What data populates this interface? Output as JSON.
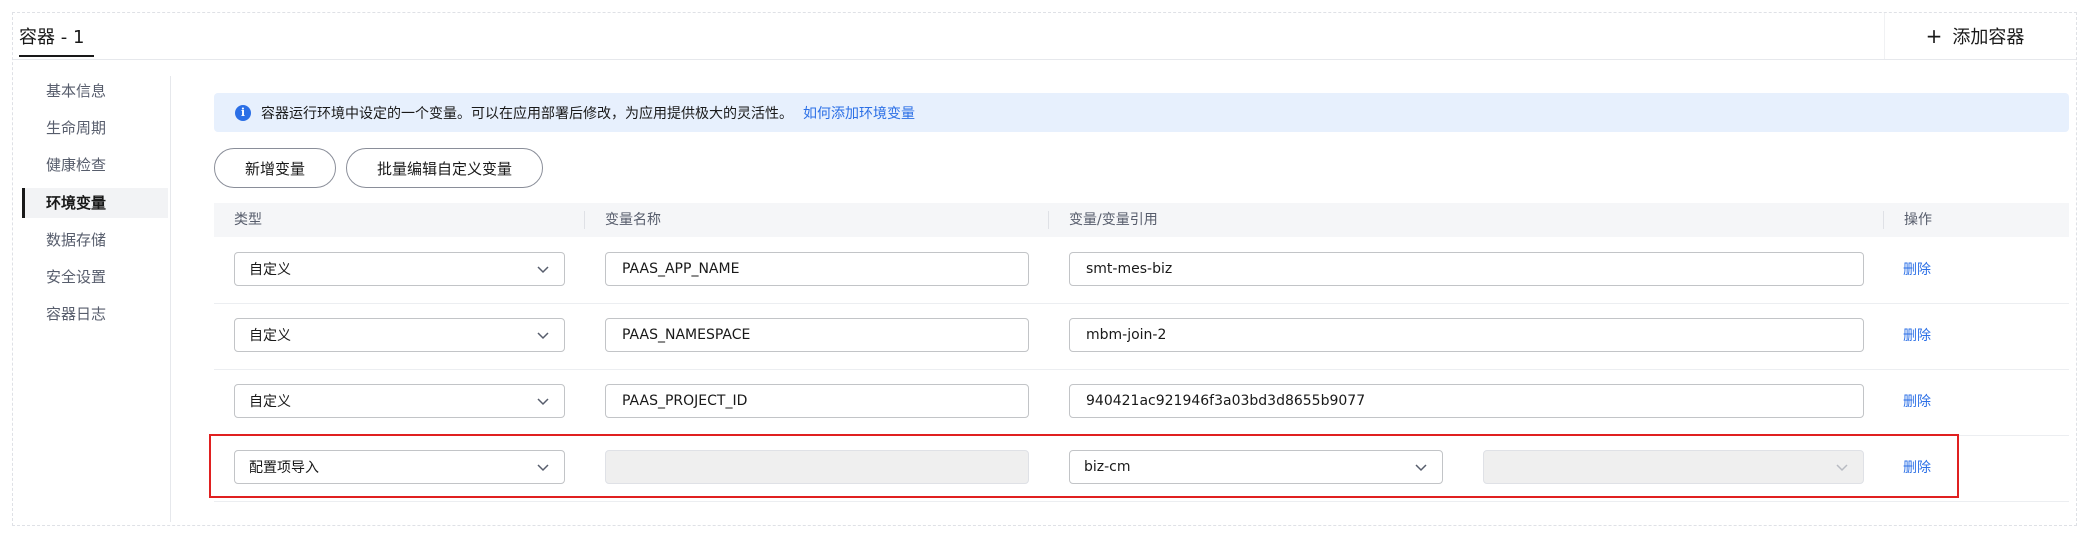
{
  "tabs": {
    "active_label": "容器 - 1"
  },
  "add_container": {
    "plus": "+",
    "label": "添加容器"
  },
  "sidebar": {
    "items": [
      {
        "label": "基本信息"
      },
      {
        "label": "生命周期"
      },
      {
        "label": "健康检查"
      },
      {
        "label": "环境变量",
        "active": true
      },
      {
        "label": "数据存储"
      },
      {
        "label": "安全设置"
      },
      {
        "label": "容器日志"
      }
    ]
  },
  "info": {
    "icon": "info-icon",
    "text": "容器运行环境中设定的一个变量。可以在应用部署后修改，为应用提供极大的灵活性。",
    "link": "如何添加环境变量"
  },
  "toolbar": {
    "add_label": "新增变量",
    "batch_label": "批量编辑自定义变量"
  },
  "table": {
    "headers": {
      "type": "类型",
      "name": "变量名称",
      "value": "变量/变量引用",
      "action": "操作"
    },
    "rows": [
      {
        "type": "自定义",
        "name": "PAAS_APP_NAME",
        "value": "smt-mes-biz",
        "action": "删除"
      },
      {
        "type": "自定义",
        "name": "PAAS_NAMESPACE",
        "value": "mbm-join-2",
        "action": "删除"
      },
      {
        "type": "自定义",
        "name": "PAAS_PROJECT_ID",
        "value": "940421ac921946f3a03bd3d8655b9077",
        "action": "删除"
      },
      {
        "type": "配置项导入",
        "name": "",
        "value": "biz-cm",
        "value2": "",
        "action": "删除"
      }
    ]
  },
  "colors": {
    "accent": "#2b6fe6",
    "highlight": "#e02020",
    "info_bg": "#e7f0fd"
  }
}
